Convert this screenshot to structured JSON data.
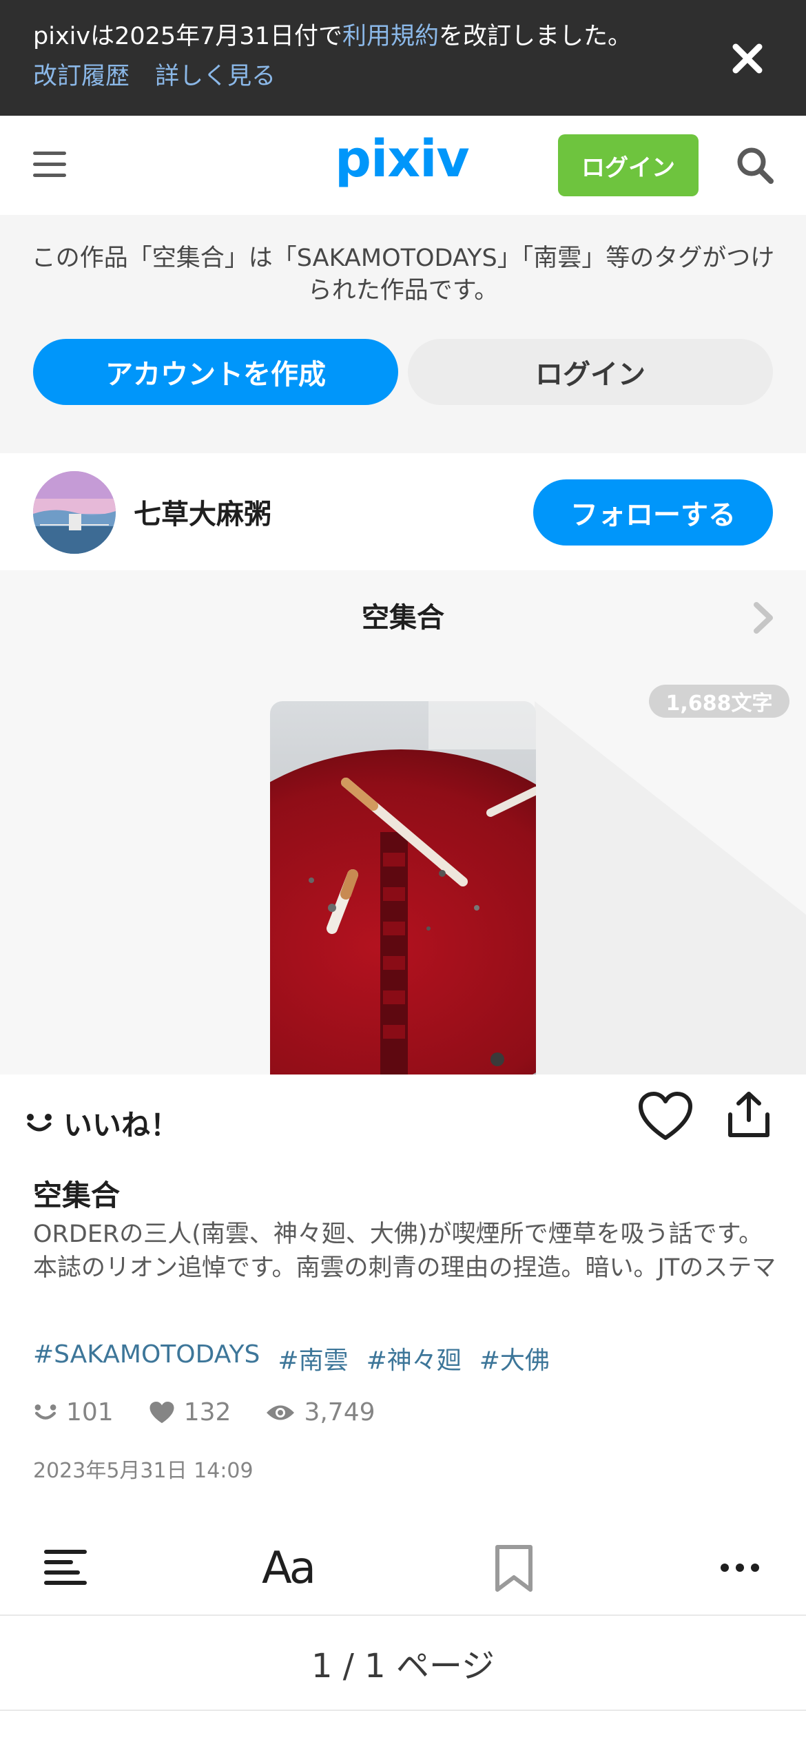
{
  "notice": {
    "text_before": "pixivは2025年7月31日付で",
    "text_link": "利用規約",
    "text_after": "を改訂しました。",
    "link_history": "改訂履歴",
    "link_details": "詳しく見る"
  },
  "header": {
    "logo": "pixiv",
    "login_label": "ログイン"
  },
  "promo": {
    "text": "この作品「空集合」は「SAKAMOTODAYS」「南雲」等のタグがつけられた作品です。",
    "create_account_label": "アカウントを作成",
    "login_label": "ログイン"
  },
  "author": {
    "name": "七草大麻粥",
    "follow_label": "フォローする"
  },
  "cover": {
    "series_title": "空集合",
    "char_count": "1,688文字"
  },
  "actions": {
    "iine_label": "いいね！"
  },
  "work": {
    "title": "空集合",
    "description": "ORDERの三人(南雲、神々廻、大佛)が喫煙所で煙草を吸う話です。本誌のリオン追悼です。南雲の刺青の理由の捏造。暗い。JTのステマ",
    "tags": [
      "#SAKAMOTODAYS",
      "#南雲",
      "#神々廻",
      "#大佛"
    ],
    "stats": {
      "iine": "101",
      "likes": "132",
      "views": "3,749"
    },
    "date": "2023年5月31日 14:09"
  },
  "toolbar": {
    "font_label": "Aa"
  },
  "pagination": {
    "label": "1 / 1 ページ"
  },
  "colors": {
    "accent": "#0096fa",
    "login_green": "#6ec43e",
    "tag_color": "#3d7699"
  }
}
